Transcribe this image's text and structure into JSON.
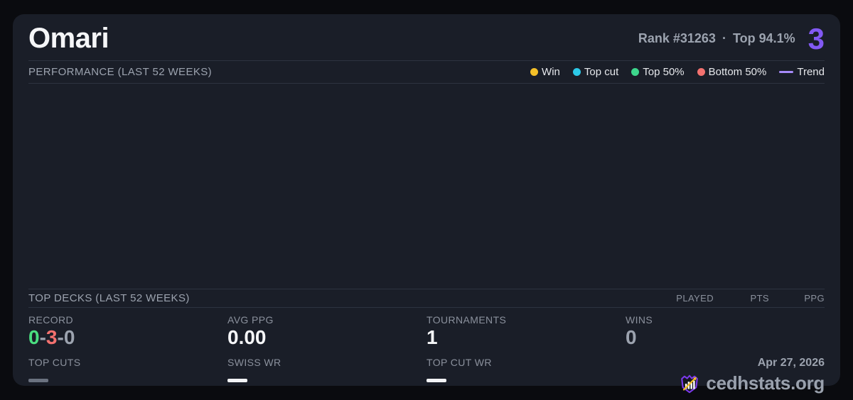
{
  "header": {
    "player_name": "Omari",
    "rank_text": "Rank #31263",
    "separator": "·",
    "top_percent_text": "Top 94.1%",
    "score": "3"
  },
  "performance": {
    "title": "PERFORMANCE (LAST 52 WEEKS)",
    "legend": [
      {
        "label": "Win",
        "color": "#f4c028",
        "swatch": "dot"
      },
      {
        "label": "Top cut",
        "color": "#2cc9e8",
        "swatch": "dot"
      },
      {
        "label": "Top 50%",
        "color": "#3dd68c",
        "swatch": "dot"
      },
      {
        "label": "Bottom 50%",
        "color": "#f3716f",
        "swatch": "dot"
      },
      {
        "label": "Trend",
        "color": "#a78bfa",
        "swatch": "line"
      }
    ],
    "chart_points": []
  },
  "top_decks": {
    "title": "TOP DECKS (LAST 52 WEEKS)",
    "columns": [
      "PLAYED",
      "PTS",
      "PPG"
    ],
    "rows": []
  },
  "stats": {
    "record": {
      "label": "RECORD",
      "wins": "0",
      "losses": "3",
      "draws": "0",
      "sep": "-",
      "wins_color": "#4ade80",
      "losses_color": "#f3716f",
      "draws_color": "#9ca3af"
    },
    "avg_ppg": {
      "label": "AVG PPG",
      "value": "0.00"
    },
    "tournaments": {
      "label": "TOURNAMENTS",
      "value": "1"
    },
    "wins": {
      "label": "WINS",
      "value": "0"
    },
    "top_cuts": {
      "label": "TOP CUTS",
      "value": ""
    },
    "swiss_wr": {
      "label": "SWISS WR",
      "value": ""
    },
    "top_cut_wr": {
      "label": "TOP CUT WR",
      "value": ""
    }
  },
  "footer": {
    "date": "Apr 27, 2026",
    "brand": "cedhstats.org"
  },
  "colors": {
    "card_background": "#1a1e28",
    "page_background": "#0a0b0f",
    "accent_purple": "#8259f3",
    "divider": "#2d3340",
    "text_primary": "#f5f6f8",
    "text_muted": "#9ca3af"
  }
}
